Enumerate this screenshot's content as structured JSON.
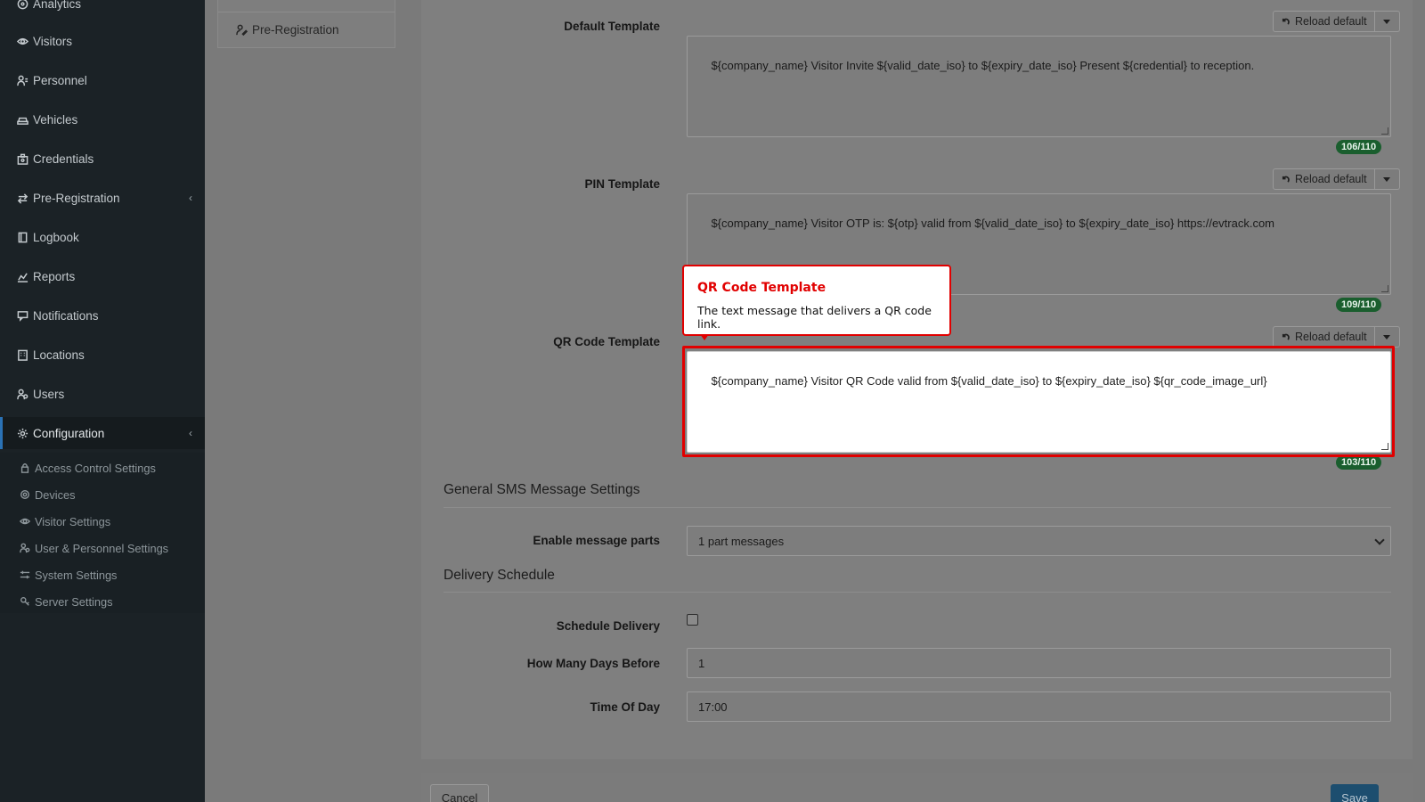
{
  "sidebar": {
    "items": [
      {
        "label": "Analytics",
        "icon": "analytics-icon"
      },
      {
        "label": "Visitors",
        "icon": "eye-icon"
      },
      {
        "label": "Personnel",
        "icon": "personnel-icon"
      },
      {
        "label": "Vehicles",
        "icon": "car-icon"
      },
      {
        "label": "Credentials",
        "icon": "badge-icon"
      },
      {
        "label": "Pre-Registration",
        "icon": "exchange-icon"
      },
      {
        "label": "Logbook",
        "icon": "book-icon"
      },
      {
        "label": "Reports",
        "icon": "chart-icon"
      },
      {
        "label": "Notifications",
        "icon": "message-icon"
      },
      {
        "label": "Locations",
        "icon": "building-icon"
      },
      {
        "label": "Users",
        "icon": "users-icon"
      },
      {
        "label": "Configuration",
        "icon": "gear-icon"
      }
    ],
    "submenu": [
      {
        "label": "Access Control Settings",
        "icon": "lock-icon"
      },
      {
        "label": "Devices",
        "icon": "device-icon"
      },
      {
        "label": "Visitor Settings",
        "icon": "eye-icon"
      },
      {
        "label": "User & Personnel Settings",
        "icon": "users-icon"
      },
      {
        "label": "System Settings",
        "icon": "sliders-icon"
      },
      {
        "label": "Server Settings",
        "icon": "server-icon"
      }
    ]
  },
  "subpanel": {
    "link_label": "Pre-Registration"
  },
  "templates": {
    "reload_label": "Reload default",
    "default": {
      "label": "Default Template",
      "value": "${company_name} Visitor Invite ${valid_date_iso} to ${expiry_date_iso} Present ${credential} to reception.",
      "counter": "106/110"
    },
    "pin": {
      "label": "PIN Template",
      "value": "${company_name} Visitor OTP is: ${otp} valid from ${valid_date_iso} to ${expiry_date_iso} https://evtrack.com",
      "counter": "109/110"
    },
    "qr": {
      "label": "QR Code Template",
      "value": "${company_name} Visitor QR Code valid from ${valid_date_iso} to ${expiry_date_iso} ${qr_code_image_url}",
      "counter": "103/110"
    }
  },
  "callout": {
    "title": "QR Code Template",
    "body": "The text message that delivers a QR code link."
  },
  "general_sms": {
    "title": "General SMS Message Settings",
    "message_parts_label": "Enable message parts",
    "message_parts_value": "1 part messages"
  },
  "delivery": {
    "title": "Delivery Schedule",
    "schedule_label": "Schedule Delivery",
    "days_label": "How Many Days Before",
    "days_value": "1",
    "time_label": "Time Of Day",
    "time_value": "17:00"
  },
  "footer": {
    "cancel_label": "Cancel",
    "save_label": "Save"
  },
  "colors": {
    "accent_red": "#e10000",
    "counter_green": "#1a5e2e",
    "sidebar_bg": "#1b2226",
    "active_border": "#2a72b5"
  }
}
